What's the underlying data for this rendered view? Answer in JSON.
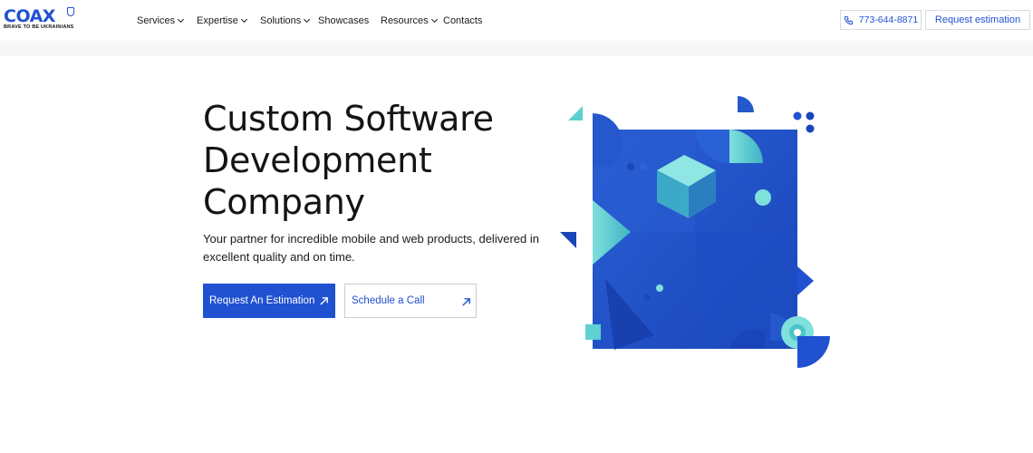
{
  "brand": {
    "logo_text": "COAX",
    "tagline": "BRAVE TO BE UKRAINIANS",
    "primary_color": "#2051d1",
    "accent_color": "#6fd8d3"
  },
  "nav": {
    "items": [
      {
        "label": "Services",
        "has_dropdown": true
      },
      {
        "label": "Expertise",
        "has_dropdown": true
      },
      {
        "label": "Solutions",
        "has_dropdown": true
      },
      {
        "label": "Showcases",
        "has_dropdown": false
      },
      {
        "label": "Resources",
        "has_dropdown": true
      },
      {
        "label": "Contacts",
        "has_dropdown": false
      }
    ]
  },
  "header_actions": {
    "phone": "773-644-8871",
    "phone_icon": "phone-icon",
    "request_label": "Request estimation"
  },
  "hero": {
    "title_lines": [
      "Custom Software",
      "Development",
      "Company"
    ],
    "subtitle": "Your partner for incredible mobile and web products, delivered in excellent quality and on time.",
    "primary_cta": "Request An Estimation",
    "secondary_cta": "Schedule a Call",
    "cta_icon": "arrow-up-right-icon",
    "illustration": "geometric-3d-illustration"
  }
}
